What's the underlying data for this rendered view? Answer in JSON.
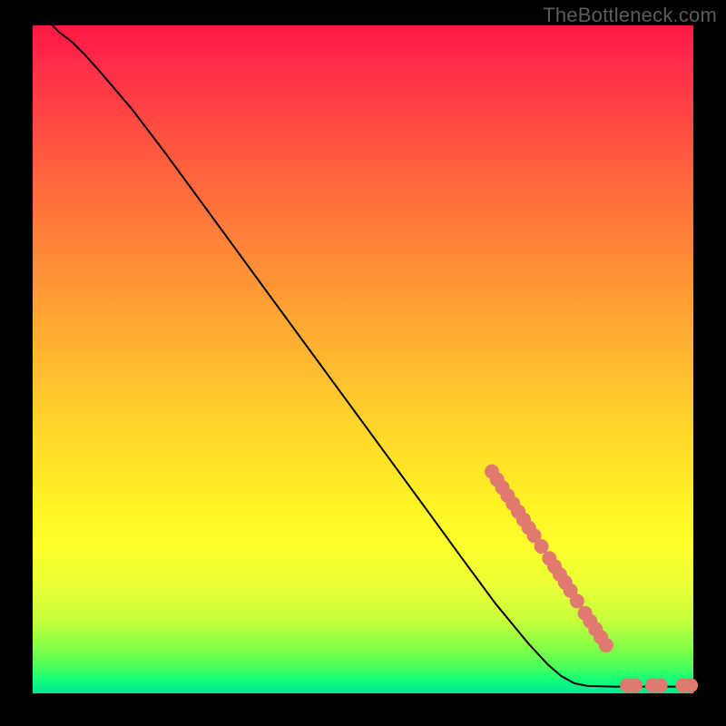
{
  "watermark": "TheBottleneck.com",
  "colors": {
    "background": "#000000",
    "watermark_text": "#5c5c5c",
    "curve_stroke": "#000000",
    "point_fill": "#e07a6f",
    "point_stroke": "#c95f55"
  },
  "chart_data": {
    "type": "line",
    "title": "",
    "xlabel": "",
    "ylabel": "",
    "xlim": [
      0,
      100
    ],
    "ylim": [
      0,
      100
    ],
    "curve": [
      {
        "x": 3,
        "y": 100
      },
      {
        "x": 4,
        "y": 99
      },
      {
        "x": 6,
        "y": 97.5
      },
      {
        "x": 8,
        "y": 95.5
      },
      {
        "x": 10,
        "y": 93.3
      },
      {
        "x": 15,
        "y": 87.5
      },
      {
        "x": 20,
        "y": 81
      },
      {
        "x": 30,
        "y": 67.5
      },
      {
        "x": 40,
        "y": 54
      },
      {
        "x": 50,
        "y": 40.5
      },
      {
        "x": 60,
        "y": 27
      },
      {
        "x": 65,
        "y": 20.2
      },
      {
        "x": 70,
        "y": 13.5
      },
      {
        "x": 75,
        "y": 7.5
      },
      {
        "x": 78,
        "y": 4.3
      },
      {
        "x": 80,
        "y": 2.6
      },
      {
        "x": 82,
        "y": 1.5
      },
      {
        "x": 84,
        "y": 1.1
      },
      {
        "x": 88,
        "y": 1.0
      },
      {
        "x": 100,
        "y": 1.0
      }
    ],
    "series": [
      {
        "name": "upper-cluster",
        "points": [
          {
            "x": 69.5,
            "y": 33.2
          },
          {
            "x": 70.3,
            "y": 32.0
          },
          {
            "x": 71.1,
            "y": 30.8
          },
          {
            "x": 71.9,
            "y": 29.6
          },
          {
            "x": 72.7,
            "y": 28.4
          },
          {
            "x": 73.5,
            "y": 27.2
          },
          {
            "x": 74.3,
            "y": 26.0
          },
          {
            "x": 75.1,
            "y": 24.8
          },
          {
            "x": 75.9,
            "y": 23.6
          },
          {
            "x": 77.0,
            "y": 22.0
          },
          {
            "x": 78.2,
            "y": 20.2
          },
          {
            "x": 79.0,
            "y": 19.0
          },
          {
            "x": 79.8,
            "y": 17.8
          },
          {
            "x": 80.6,
            "y": 16.6
          },
          {
            "x": 81.4,
            "y": 15.4
          },
          {
            "x": 82.4,
            "y": 13.8
          },
          {
            "x": 83.6,
            "y": 12.0
          },
          {
            "x": 84.4,
            "y": 10.8
          },
          {
            "x": 85.2,
            "y": 9.6
          },
          {
            "x": 86.0,
            "y": 8.4
          },
          {
            "x": 86.8,
            "y": 7.2
          }
        ]
      },
      {
        "name": "floor-cluster",
        "points": [
          {
            "x": 90.0,
            "y": 1.2
          },
          {
            "x": 91.2,
            "y": 1.2
          },
          {
            "x": 93.8,
            "y": 1.2
          },
          {
            "x": 95.0,
            "y": 1.2
          },
          {
            "x": 98.4,
            "y": 1.2
          },
          {
            "x": 99.6,
            "y": 1.2
          }
        ]
      }
    ]
  }
}
